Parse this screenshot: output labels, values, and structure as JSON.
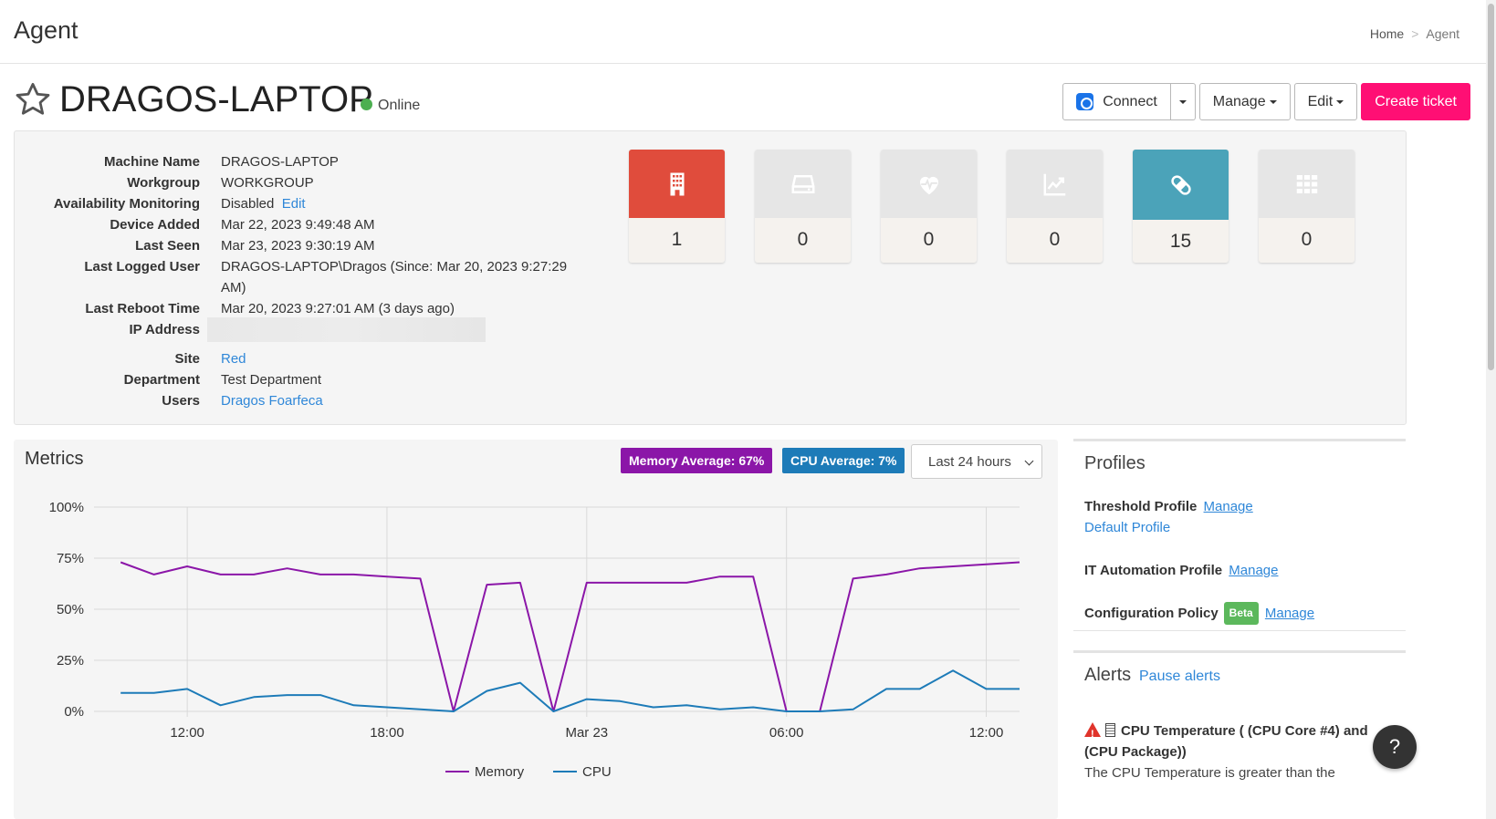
{
  "header": {
    "title": "Agent",
    "breadcrumb": {
      "home": "Home",
      "separator": ">",
      "current": "Agent"
    }
  },
  "device": {
    "name": "DRAGOS-LAPTOP",
    "status": "Online",
    "status_color": "#4caf50"
  },
  "actions": {
    "connect": "Connect",
    "manage": "Manage",
    "edit": "Edit",
    "create_ticket": "Create ticket",
    "ticket_color": "#ff0f74"
  },
  "info": {
    "rows": [
      {
        "label": "Machine Name",
        "value": "DRAGOS-LAPTOP"
      },
      {
        "label": "Workgroup",
        "value": "WORKGROUP"
      },
      {
        "label": "Availability Monitoring",
        "value": "Disabled",
        "link": "Edit"
      },
      {
        "label": "Device Added",
        "value": "Mar 22, 2023 9:49:48 AM"
      },
      {
        "label": "Last Seen",
        "value": "Mar 23, 2023 9:30:19 AM"
      },
      {
        "label": "Last Logged User",
        "value": "DRAGOS-LAPTOP\\Dragos (Since: Mar 20, 2023 9:27:29 AM)"
      },
      {
        "label": "Last Reboot Time",
        "value": "Mar 20, 2023 9:27:01 AM (3 days ago)"
      },
      {
        "label": "IP Address",
        "value": ""
      },
      {
        "label": "Site",
        "link": "Red"
      },
      {
        "label": "Department",
        "value": "Test Department"
      },
      {
        "label": "Users",
        "link": "Dragos Foarfeca"
      }
    ]
  },
  "tiles": [
    {
      "icon": "building-icon",
      "count": "1",
      "color": "#e04c3c"
    },
    {
      "icon": "hard-drive-icon",
      "count": "0",
      "color": "#e6e6e6"
    },
    {
      "icon": "heartbeat-icon",
      "count": "0",
      "color": "#e6e6e6"
    },
    {
      "icon": "chart-up-icon",
      "count": "0",
      "color": "#e6e6e6"
    },
    {
      "icon": "bandage-icon",
      "count": "15",
      "color": "#4ba3b9"
    },
    {
      "icon": "grid-icon",
      "count": "0",
      "color": "#e6e6e6"
    }
  ],
  "metrics": {
    "title": "Metrics",
    "memory_badge": "Memory Average: 67%",
    "cpu_badge": "CPU Average: 7%",
    "range": "Last 24 hours",
    "memory_color": "#8b16a8",
    "cpu_color": "#1d7bb8"
  },
  "chart_data": {
    "type": "line",
    "ylim": [
      0,
      100
    ],
    "y_ticks": [
      "0%",
      "25%",
      "50%",
      "75%",
      "100%"
    ],
    "x_ticks": [
      "12:00",
      "18:00",
      "Mar 23",
      "06:00",
      "12:00"
    ],
    "x_tick_hours": [
      12,
      18,
      24,
      30,
      36
    ],
    "x_range_hours": [
      9.2,
      37.0
    ],
    "grid": true,
    "legend_position": "bottom",
    "series": [
      {
        "name": "Memory",
        "color": "#8b16a8",
        "x": [
          10,
          11,
          12,
          13,
          14,
          15,
          16,
          17,
          18,
          19,
          20,
          21,
          22,
          23,
          24,
          25,
          26,
          27,
          28,
          29,
          30,
          31,
          32,
          33,
          34,
          35,
          36,
          37
        ],
        "values": [
          73,
          67,
          71,
          67,
          67,
          70,
          67,
          67,
          66,
          65,
          0,
          62,
          63,
          0,
          63,
          63,
          63,
          63,
          66,
          66,
          0,
          0,
          65,
          67,
          70,
          71,
          72,
          73
        ]
      },
      {
        "name": "CPU",
        "color": "#1d7bb8",
        "x": [
          10,
          11,
          12,
          13,
          14,
          15,
          16,
          17,
          18,
          19,
          20,
          21,
          22,
          23,
          24,
          25,
          26,
          27,
          28,
          29,
          30,
          31,
          32,
          33,
          34,
          35,
          36,
          37
        ],
        "values": [
          9,
          9,
          11,
          3,
          7,
          8,
          8,
          3,
          2,
          1,
          0,
          10,
          14,
          0,
          6,
          5,
          2,
          3,
          1,
          2,
          0,
          0,
          1,
          11,
          11,
          20,
          11,
          11
        ]
      }
    ]
  },
  "profiles": {
    "title": "Profiles",
    "threshold_label": "Threshold Profile",
    "threshold_manage": "Manage",
    "threshold_value": "Default Profile",
    "it_automation_label": "IT Automation Profile",
    "it_automation_manage": "Manage",
    "config_label": "Configuration Policy",
    "config_badge": "Beta",
    "config_manage": "Manage"
  },
  "alerts": {
    "title": "Alerts",
    "pause": "Pause alerts",
    "item_title": "CPU Temperature ( (CPU Core #4) and (CPU Package))",
    "item_desc": "The CPU Temperature is greater than the"
  },
  "help": {
    "label": "?"
  }
}
